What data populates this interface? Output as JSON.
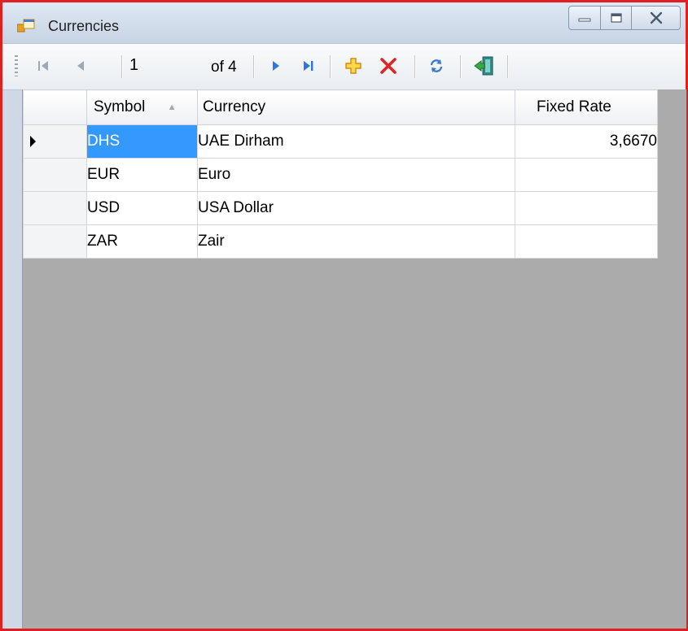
{
  "window": {
    "title": "Currencies",
    "icons": {
      "app": "form-icon",
      "minimize": "minimize-icon",
      "maximize": "maximize-icon",
      "close": "close-icon"
    }
  },
  "navigator": {
    "position": "1",
    "count_label": "of 4",
    "icons": [
      "move-first-icon",
      "move-previous-icon",
      "move-next-icon",
      "move-last-icon",
      "add-new-icon",
      "delete-icon",
      "refresh-icon",
      "exit-icon"
    ]
  },
  "grid": {
    "columns": [
      "Symbol",
      "Currency",
      "Fixed Rate"
    ],
    "sorted_column": "Symbol",
    "sort_direction": "ascending",
    "current_row": 0,
    "rows": [
      {
        "symbol": "DHS",
        "currency": "UAE Dirham",
        "rate": "3,6670"
      },
      {
        "symbol": "EUR",
        "currency": "Euro",
        "rate": ""
      },
      {
        "symbol": "USD",
        "currency": "USA Dollar",
        "rate": ""
      },
      {
        "symbol": "ZAR",
        "currency": "Zair",
        "rate": ""
      }
    ]
  },
  "colors": {
    "selection": "#3399ff",
    "grid_background": "#ababab",
    "window_border": "#e02020"
  }
}
